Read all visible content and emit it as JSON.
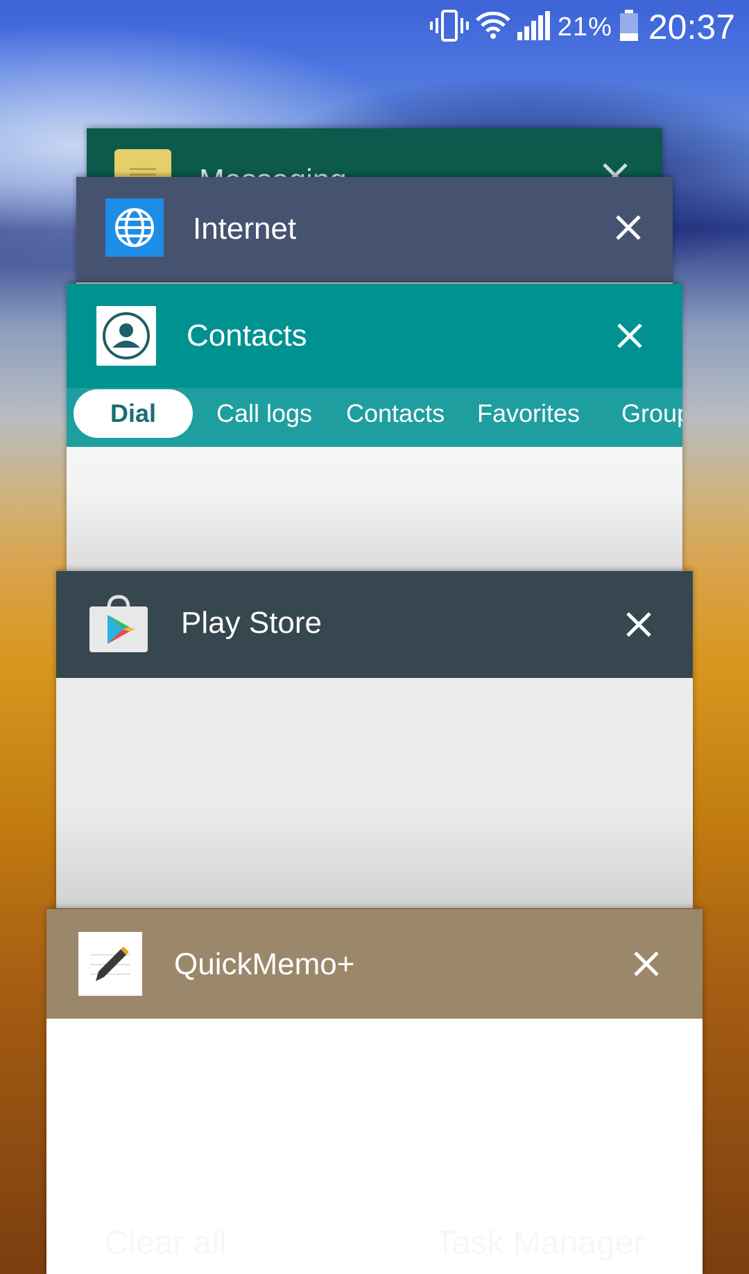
{
  "status_bar": {
    "battery_percent": "21%",
    "time": "20:37",
    "icons": [
      "vibrate-icon",
      "wifi-icon",
      "signal-icon",
      "battery-icon"
    ]
  },
  "cards": {
    "messaging": {
      "title": "Messaging",
      "header_color": "#0b5a4c"
    },
    "internet": {
      "title": "Internet",
      "header_color": "#465370"
    },
    "contacts": {
      "title": "Contacts",
      "header_color": "#009191",
      "tabs": [
        "Dial",
        "Call logs",
        "Contacts",
        "Favorites",
        "Groups"
      ],
      "active_tab": "Dial"
    },
    "play_store": {
      "title": "Play Store",
      "header_color": "#37474f"
    },
    "quickmemo": {
      "title": "QuickMemo+",
      "header_color": "#9b876a"
    }
  },
  "bottom_actions": {
    "clear_all": "Clear all",
    "task_manager": "Task Manager"
  }
}
